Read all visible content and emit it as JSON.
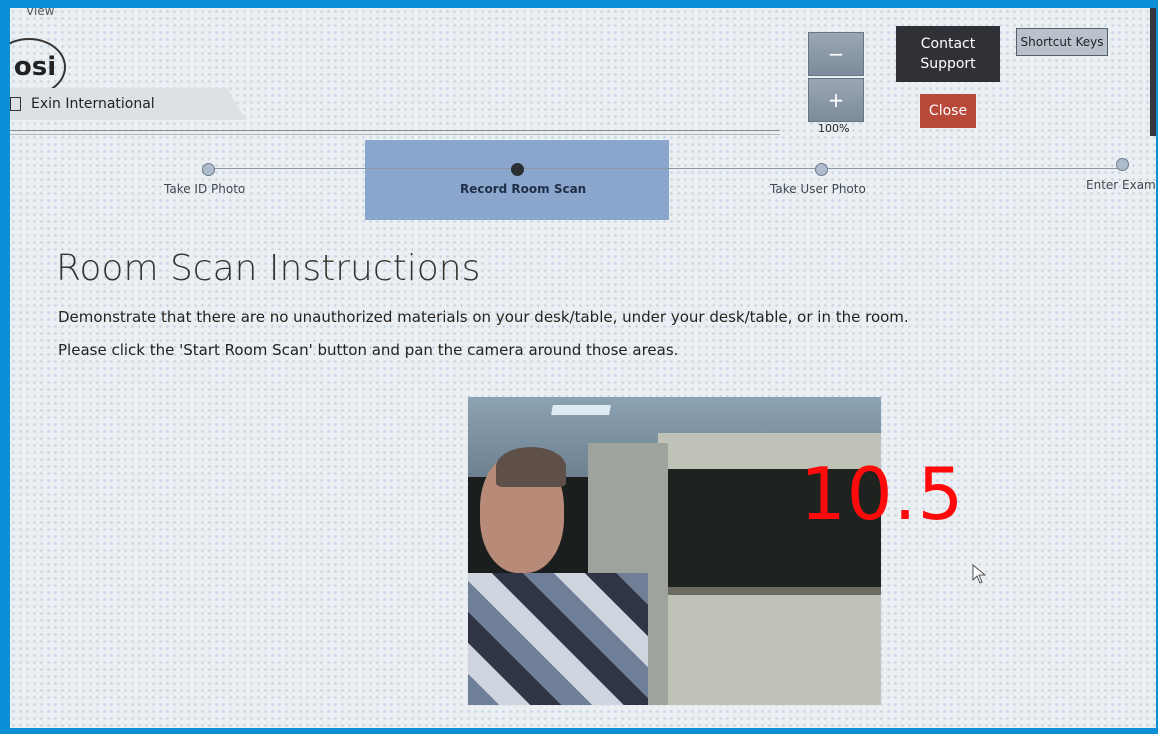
{
  "menu": {
    "view_label": "View"
  },
  "logo": {
    "text": "osi"
  },
  "org": {
    "name": "Exin International"
  },
  "toolbar": {
    "zoom_out_label": "−",
    "zoom_in_label": "+",
    "zoom_level": "100%",
    "contact_support_label": "Contact Support",
    "close_label": "Close",
    "shortcut_keys_label": "Shortcut Keys"
  },
  "steps": [
    {
      "label": "Take ID Photo",
      "active": false
    },
    {
      "label": "Record Room Scan",
      "active": true
    },
    {
      "label": "Take User Photo",
      "active": false
    },
    {
      "label": "Enter Exam",
      "active": false
    }
  ],
  "main": {
    "title": "Room Scan Instructions",
    "instruction_1": "Demonstrate that there are no unauthorized materials on your desk/table, under your desk/table, or in the room.",
    "instruction_2": "Please click the 'Start Room Scan' button and pan the camera around those areas."
  },
  "overlay": {
    "timer_text": "10.5",
    "timer_color": "#ff0a0a"
  },
  "colors": {
    "active_step_band": "#8aa6cc",
    "close_button": "#b84838",
    "contact_button": "#2f3136",
    "frame": "#0d8fd8"
  },
  "icons": {
    "org_tab": "document-icon",
    "mouse": "mouse-cursor-icon"
  }
}
